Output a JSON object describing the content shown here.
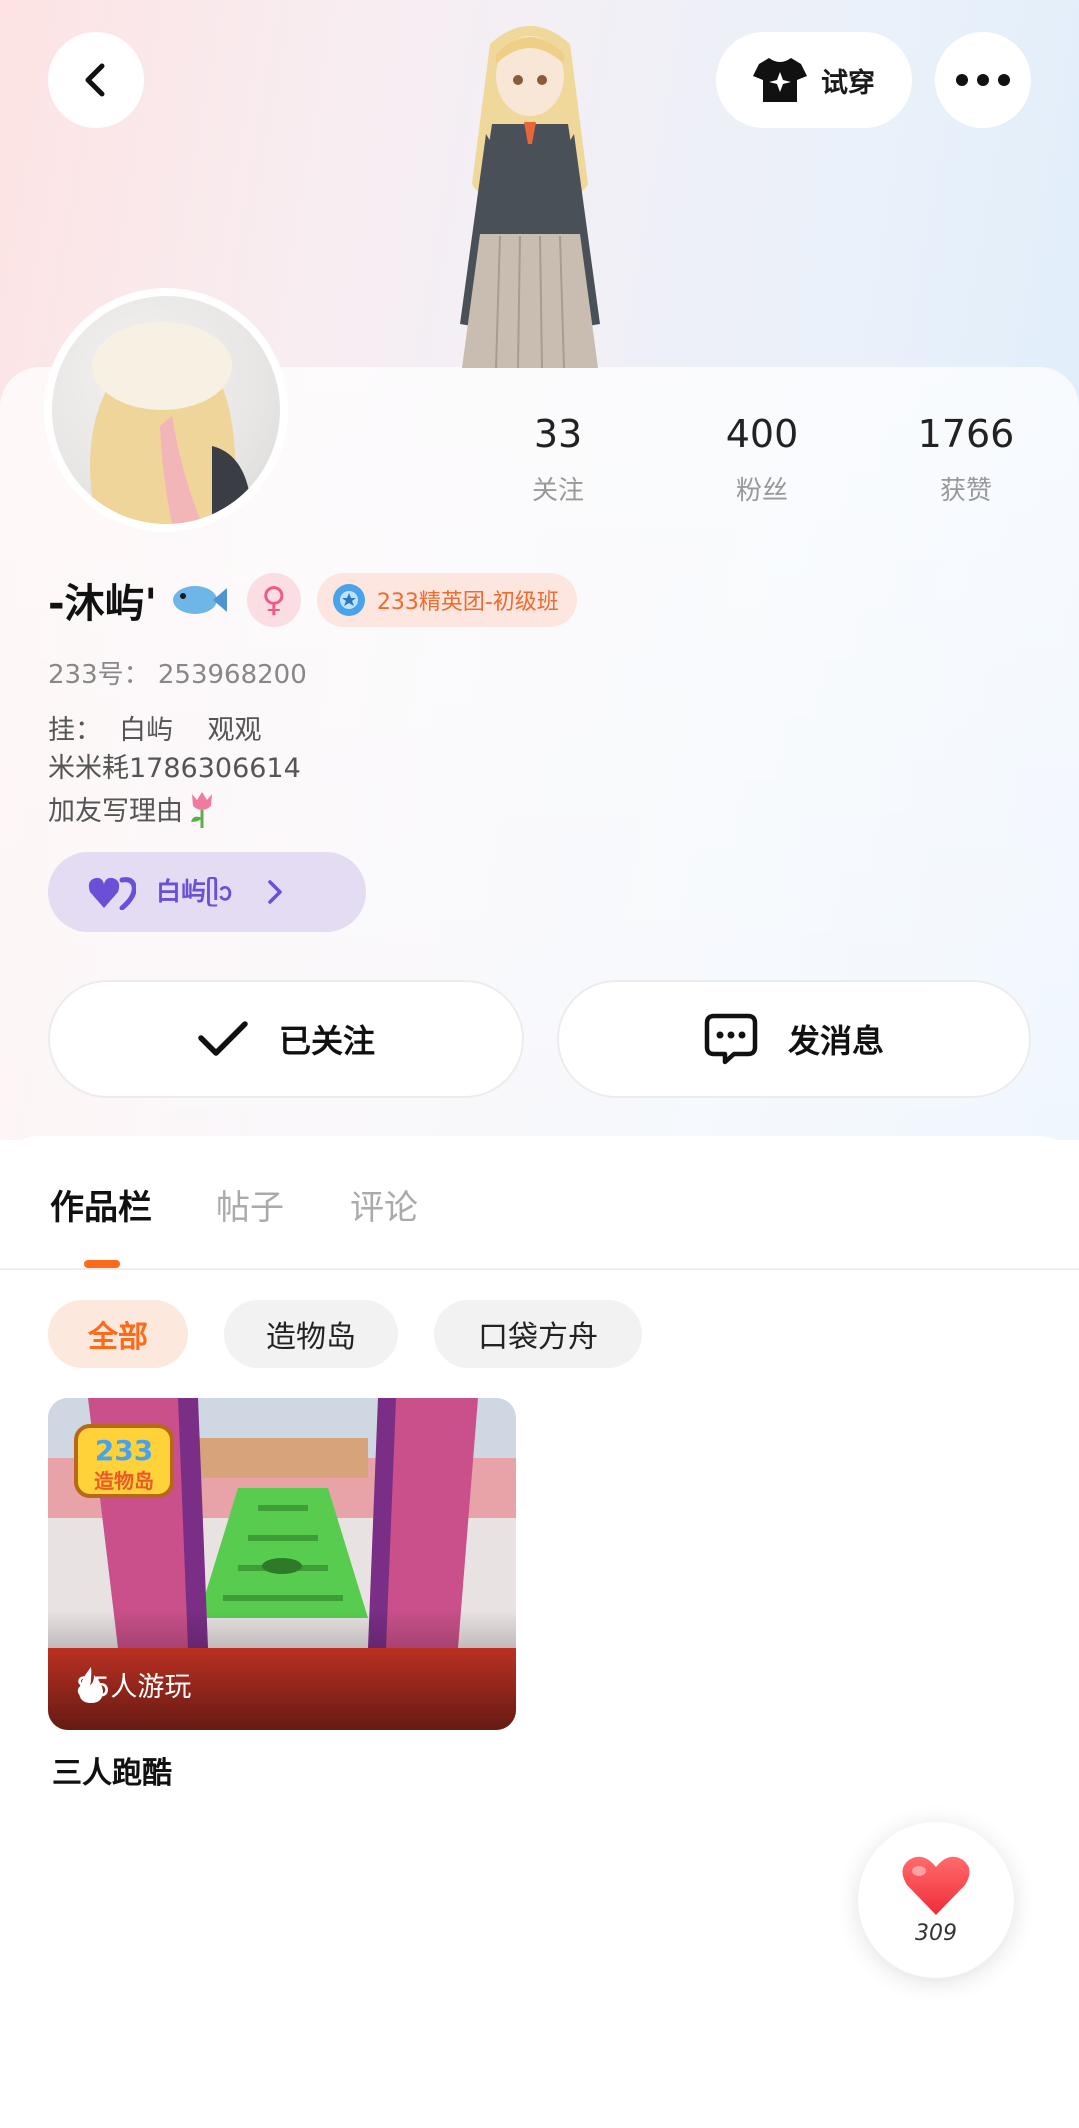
{
  "header": {
    "try_on_label": "试穿"
  },
  "stats": [
    {
      "value": "33",
      "label": "关注"
    },
    {
      "value": "400",
      "label": "粉丝"
    },
    {
      "value": "1766",
      "label": "获赞"
    }
  ],
  "profile": {
    "name": "-沐屿'",
    "gender_symbol": "♀",
    "club_badge": "233精英团-初级班",
    "uid": "233号：  253968200",
    "bio_lines": [
      "挂：  白屿    观观",
      "米米耗1786306614",
      "加友写理由"
    ],
    "partner_label": "白屿ᥫᩣ"
  },
  "actions": {
    "follow_label": "已关注",
    "message_label": "发消息"
  },
  "tabs": [
    {
      "label": "作品栏",
      "active": true
    },
    {
      "label": "帖子",
      "active": false
    },
    {
      "label": "评论",
      "active": false
    }
  ],
  "filters": [
    {
      "label": "全部",
      "active": true
    },
    {
      "label": "造物岛",
      "active": false
    },
    {
      "label": "口袋方舟",
      "active": false
    }
  ],
  "works": [
    {
      "title": "三人跑酷",
      "players": "85人游玩",
      "logo_text": "233",
      "logo_sub": "造物岛"
    }
  ],
  "like_fab": {
    "count": "309"
  },
  "colors": {
    "accent": "#ff6a1a",
    "partner_purple": "#6b4fd6",
    "gender_pink": "#ee5c84"
  }
}
